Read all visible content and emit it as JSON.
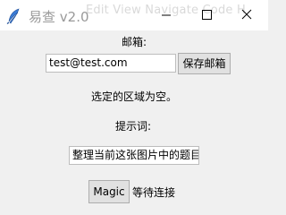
{
  "window": {
    "title": "易查 v2.0",
    "background_menu_text": "Edit  View  Navigate  Code  H"
  },
  "email": {
    "label": "邮箱:",
    "value": "test@test.com",
    "save_button": "保存邮箱"
  },
  "selection": {
    "status": "选定的区域为空。"
  },
  "prompt": {
    "label": "提示词:",
    "value": "整理当前这张图片中的题目"
  },
  "actions": {
    "magic_button": "Magic",
    "connection_status": "等待连接"
  }
}
